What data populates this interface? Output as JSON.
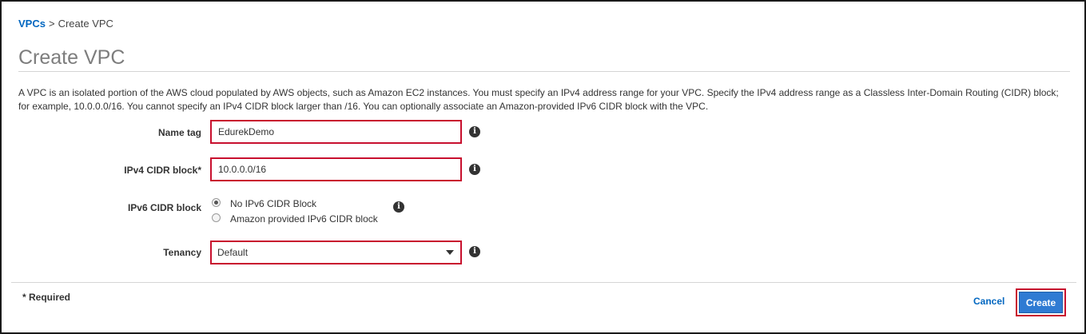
{
  "breadcrumb": {
    "parent_label": "VPCs",
    "separator": ">",
    "current_label": "Create VPC"
  },
  "page": {
    "title": "Create VPC",
    "description": "A VPC is an isolated portion of the AWS cloud populated by AWS objects, such as Amazon EC2 instances. You must specify an IPv4 address range for your VPC. Specify the IPv4 address range as a Classless Inter-Domain Routing (CIDR) block; for example, 10.0.0.0/16. You cannot specify an IPv4 CIDR block larger than /16. You can optionally associate an Amazon-provided IPv6 CIDR block with the VPC."
  },
  "form": {
    "name_tag": {
      "label": "Name tag",
      "value": "EdurekDemo"
    },
    "ipv4_cidr": {
      "label": "IPv4 CIDR block*",
      "value": "10.0.0.0/16"
    },
    "ipv6_cidr": {
      "label": "IPv6 CIDR block",
      "options": [
        {
          "label": "No IPv6 CIDR Block",
          "selected": true
        },
        {
          "label": "Amazon provided IPv6 CIDR block",
          "selected": false
        }
      ]
    },
    "tenancy": {
      "label": "Tenancy",
      "selected": "Default"
    },
    "info_icon_glyph": "i"
  },
  "footer": {
    "required_note": "* Required",
    "cancel_label": "Cancel",
    "create_label": "Create"
  },
  "colors": {
    "link": "#0066c0",
    "highlight_border": "#c8102e",
    "primary_button": "#2f7bd3"
  },
  "icons": {
    "info": "info-circle-icon",
    "dropdown": "chevron-down-icon",
    "radio_selected": "radio-checked-icon",
    "radio_unselected": "radio-unchecked-icon"
  }
}
